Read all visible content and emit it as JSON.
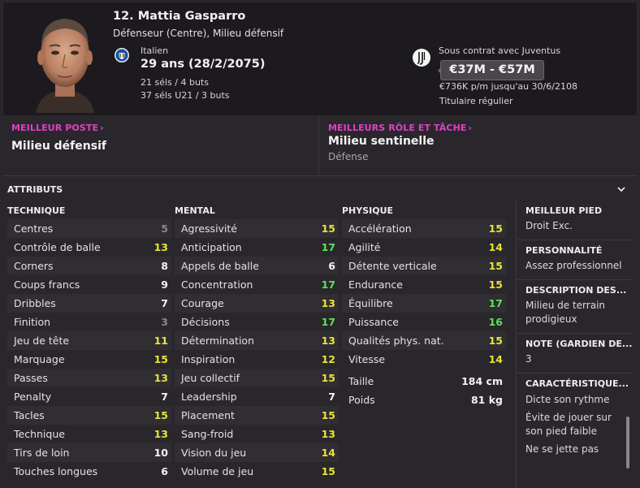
{
  "player": {
    "name": "12. Mattia Gasparro",
    "positions": "Défenseur (Centre), Milieu défensif",
    "nationality": "Italien",
    "age": "29 ans (28/2/2075)",
    "caps": "21 séls / 4 buts",
    "u21_caps": "37 séls U21 / 3 buts",
    "contract": "Sous contrat avec Juventus",
    "value": "€37M - €57M",
    "wage": "€736K p/m jusqu'au 30/6/2108",
    "status": "Titulaire régulier"
  },
  "roles": {
    "best_position_label": "MEILLEUR POSTE",
    "best_position": "Milieu défensif",
    "best_role_label": "MEILLEURS RÔLE ET TÂCHE",
    "best_role": "Milieu sentinelle",
    "best_role_duty": "Défense"
  },
  "attributes": {
    "title": "ATTRIBUTS",
    "technique_head": "TECHNIQUE",
    "mental_head": "MENTAL",
    "physique_head": "PHYSIQUE",
    "technique": [
      {
        "label": "Centres",
        "value": "5"
      },
      {
        "label": "Contrôle de balle",
        "value": "13"
      },
      {
        "label": "Corners",
        "value": "8"
      },
      {
        "label": "Coups francs",
        "value": "9"
      },
      {
        "label": "Dribbles",
        "value": "7"
      },
      {
        "label": "Finition",
        "value": "3"
      },
      {
        "label": "Jeu de tête",
        "value": "11"
      },
      {
        "label": "Marquage",
        "value": "15"
      },
      {
        "label": "Passes",
        "value": "13"
      },
      {
        "label": "Penalty",
        "value": "7"
      },
      {
        "label": "Tacles",
        "value": "15"
      },
      {
        "label": "Technique",
        "value": "13"
      },
      {
        "label": "Tirs de loin",
        "value": "10"
      },
      {
        "label": "Touches longues",
        "value": "6"
      }
    ],
    "mental": [
      {
        "label": "Agressivité",
        "value": "15"
      },
      {
        "label": "Anticipation",
        "value": "17"
      },
      {
        "label": "Appels de balle",
        "value": "6"
      },
      {
        "label": "Concentration",
        "value": "17"
      },
      {
        "label": "Courage",
        "value": "13"
      },
      {
        "label": "Décisions",
        "value": "17"
      },
      {
        "label": "Détermination",
        "value": "13"
      },
      {
        "label": "Inspiration",
        "value": "12"
      },
      {
        "label": "Jeu collectif",
        "value": "15"
      },
      {
        "label": "Leadership",
        "value": "7"
      },
      {
        "label": "Placement",
        "value": "15"
      },
      {
        "label": "Sang-froid",
        "value": "13"
      },
      {
        "label": "Vision du jeu",
        "value": "14"
      },
      {
        "label": "Volume de jeu",
        "value": "15"
      }
    ],
    "physique": [
      {
        "label": "Accélération",
        "value": "15"
      },
      {
        "label": "Agilité",
        "value": "14"
      },
      {
        "label": "Détente verticale",
        "value": "15"
      },
      {
        "label": "Endurance",
        "value": "15"
      },
      {
        "label": "Équilibre",
        "value": "17"
      },
      {
        "label": "Puissance",
        "value": "16"
      },
      {
        "label": "Qualités phys. nat.",
        "value": "15"
      },
      {
        "label": "Vitesse",
        "value": "14"
      }
    ],
    "height_label": "Taille",
    "height": "184 cm",
    "weight_label": "Poids",
    "weight": "81 kg"
  },
  "info": {
    "foot_head": "MEILLEUR PIED",
    "foot": "Droit Exc.",
    "personality_head": "PERSONNALITÉ",
    "personality": "Assez professionnel",
    "description_head": "DESCRIPTION DES...",
    "description": "Milieu de terrain prodigieux",
    "gk_head": "NOTE (GARDIEN DE...",
    "gk": "3",
    "traits_head": "CARACTÉRISTIQUE...",
    "traits": [
      "Dicte son rythme",
      "Évite de jouer sur son pied faible",
      "Ne se jette pas"
    ]
  },
  "colors": {
    "low": "#8a878c",
    "mid": "#f4f2f6",
    "good": "#e8e23a",
    "great": "#5ee05a",
    "accent": "#e040c8"
  }
}
